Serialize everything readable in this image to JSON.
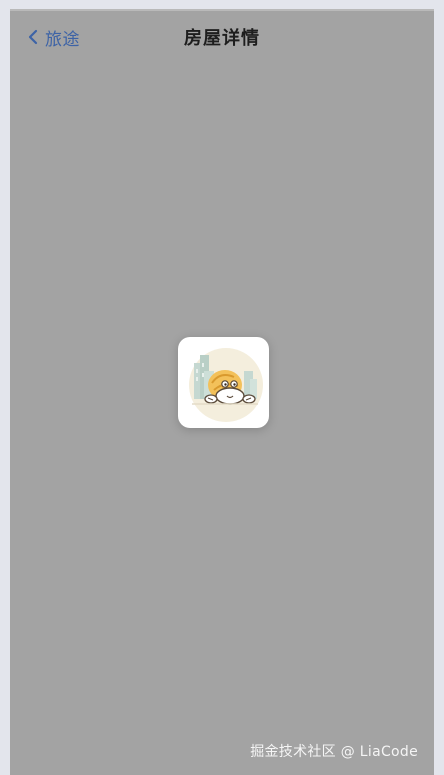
{
  "header": {
    "back_label": "旅途",
    "title": "房屋详情"
  },
  "loading": {
    "mascot_icon": "hermit-crab-mascot-icon"
  },
  "watermark": {
    "text": "掘金技术社区 @ LiaCode"
  },
  "colors": {
    "overlay": "#a3a3a3",
    "back_link": "#3d63a6",
    "title": "#1e1e1e",
    "page_background": "#e3e5ec"
  }
}
